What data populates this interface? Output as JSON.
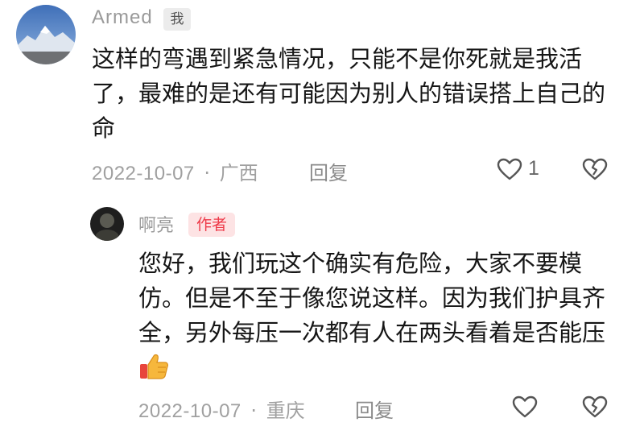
{
  "comment": {
    "username": "Armed",
    "me_badge": "我",
    "text": "这样的弯遇到紧急情况，只能不是你死就是我活了，最难的是还有可能因为别人的错误搭上自己的命",
    "date": "2022-10-07",
    "separator": "·",
    "location": "广西",
    "reply_label": "回复",
    "like_count": "1",
    "icons": {
      "like": "heart-outline-icon",
      "dislike": "broken-heart-icon"
    }
  },
  "reply": {
    "username": "啊亮",
    "author_badge": "作者",
    "text": "您好，我们玩这个确实有危险，大家不要模仿。但是不至于像您说这样。因为我们护具齐全，另外每压一次都有人在两头看着是否能压",
    "emoji": "thumbs-up-emoji",
    "date": "2022-10-07",
    "separator": "·",
    "location": "重庆",
    "reply_label": "回复",
    "icons": {
      "like": "heart-outline-icon",
      "dislike": "broken-heart-icon"
    }
  },
  "colors": {
    "author_badge_bg": "#fde3e4",
    "author_badge_text": "#ee3b4a",
    "meta_text": "#a0a0a0"
  }
}
